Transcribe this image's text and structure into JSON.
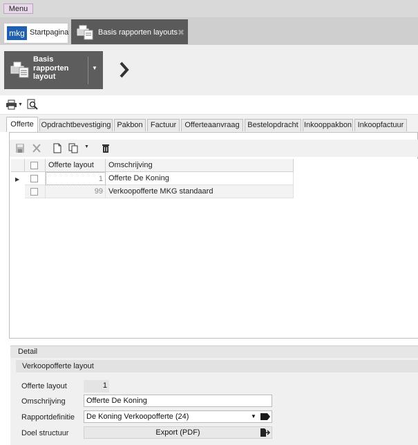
{
  "menu": {
    "label": "Menu"
  },
  "app_tabs": {
    "start": {
      "badge": "mkg",
      "label": "Startpagina"
    },
    "layouts": {
      "label": "Basis rapporten layouts",
      "close_icon": "close-icon"
    }
  },
  "header": {
    "primary_button": {
      "line1": "Basis",
      "line2": "rapporten",
      "line3": "layout"
    }
  },
  "toolbar": {
    "icons": [
      "printer-icon",
      "print-preview-icon"
    ]
  },
  "document_tabs": [
    "Offerte",
    "Opdrachtbevestiging",
    "Pakbon",
    "Factuur",
    "Offerteaanvraag",
    "Bestelopdracht",
    "Inkooppakbon",
    "Inkoopfactuur"
  ],
  "active_tab": "Offerte",
  "grid_toolbar": {
    "icons": [
      "save-icon",
      "cancel-icon",
      "new-document-icon",
      "copy-icon",
      "delete-icon"
    ]
  },
  "grid": {
    "columns": [
      "Offerte layout",
      "Omschrijving"
    ],
    "rows": [
      {
        "layout": "1",
        "omschrijving": "Offerte De Koning"
      },
      {
        "layout": "99",
        "omschrijving": "Verkoopofferte MKG standaard"
      }
    ]
  },
  "detail": {
    "title": "Detail",
    "section_title": "Verkoopofferte layout",
    "fields": {
      "offerte_layout": {
        "label": "Offerte layout",
        "value": "1"
      },
      "omschrijving": {
        "label": "Omschrijving",
        "value": "Offerte De Koning"
      },
      "rapportdefinitie": {
        "label": "Rapportdefinitie",
        "value": "De Koning Verkoopofferte (24)"
      },
      "doel_structuur": {
        "label": "Doel structuur",
        "value": "Export (PDF)"
      }
    }
  },
  "colors": {
    "accent_blue": "#1f5fae",
    "dark_tab": "#5a5a5a",
    "menu_purple": "#e8d9ea"
  }
}
